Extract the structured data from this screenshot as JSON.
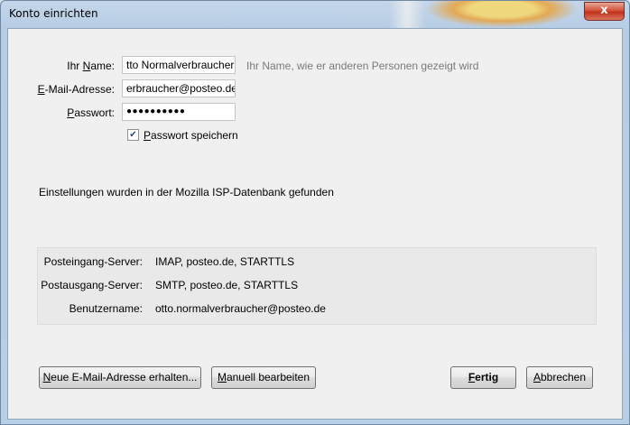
{
  "window": {
    "title": "Konto einrichten",
    "close_glyph": "x"
  },
  "form": {
    "name_label_pre": "Ihr ",
    "name_label_u": "N",
    "name_label_post": "ame:",
    "name_value": "tto Normalverbraucher",
    "name_hint": "Ihr Name, wie er anderen Personen gezeigt wird",
    "email_label_u": "E",
    "email_label_post": "-Mail-Adresse:",
    "email_value": "erbraucher@posteo.de",
    "password_label_u": "P",
    "password_label_post": "asswort:",
    "password_value": "●●●●●●●●●●",
    "remember_checked": true,
    "remember_label_u": "P",
    "remember_label_post": "asswort speichern"
  },
  "status_message": "Einstellungen wurden in der Mozilla ISP-Datenbank gefunden",
  "servers": [
    {
      "label": "Posteingang-Server:",
      "value": "IMAP, posteo.de, STARTTLS"
    },
    {
      "label": "Postausgang-Server:",
      "value": "SMTP, posteo.de, STARTTLS"
    },
    {
      "label": "Benutzername:",
      "value": "otto.normalverbraucher@posteo.de"
    }
  ],
  "buttons": {
    "new_address_u": "N",
    "new_address_post": "eue E-Mail-Adresse erhalten...",
    "manual_u": "M",
    "manual_post": "anuell bearbeiten",
    "done_u": "F",
    "done_post": "ertig",
    "cancel_u": "A",
    "cancel_post": "bbrechen"
  }
}
